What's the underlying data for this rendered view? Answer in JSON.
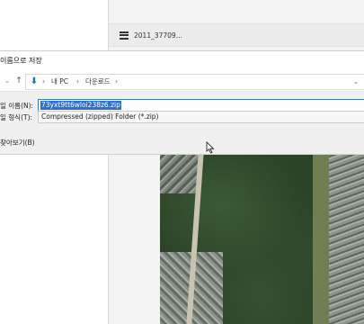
{
  "background": {
    "file_name": "2011_37709..."
  },
  "dialog": {
    "title": "이름으로 저장",
    "address": {
      "crumbs": [
        "내 PC",
        "다운로드"
      ]
    },
    "filename_label": "일 이름(N):",
    "filename_value": "73yxt9tt6wloi238z6.zip",
    "filetype_label": "일 형식(T):",
    "filetype_value": "Compressed (zipped) Folder (*.zip)",
    "browse_label": "찾아보기(B)"
  },
  "colors": {
    "selection": "#2f70c9",
    "folder_icon": "#2a73c9",
    "dialog_bg": "#f0f0f0"
  }
}
